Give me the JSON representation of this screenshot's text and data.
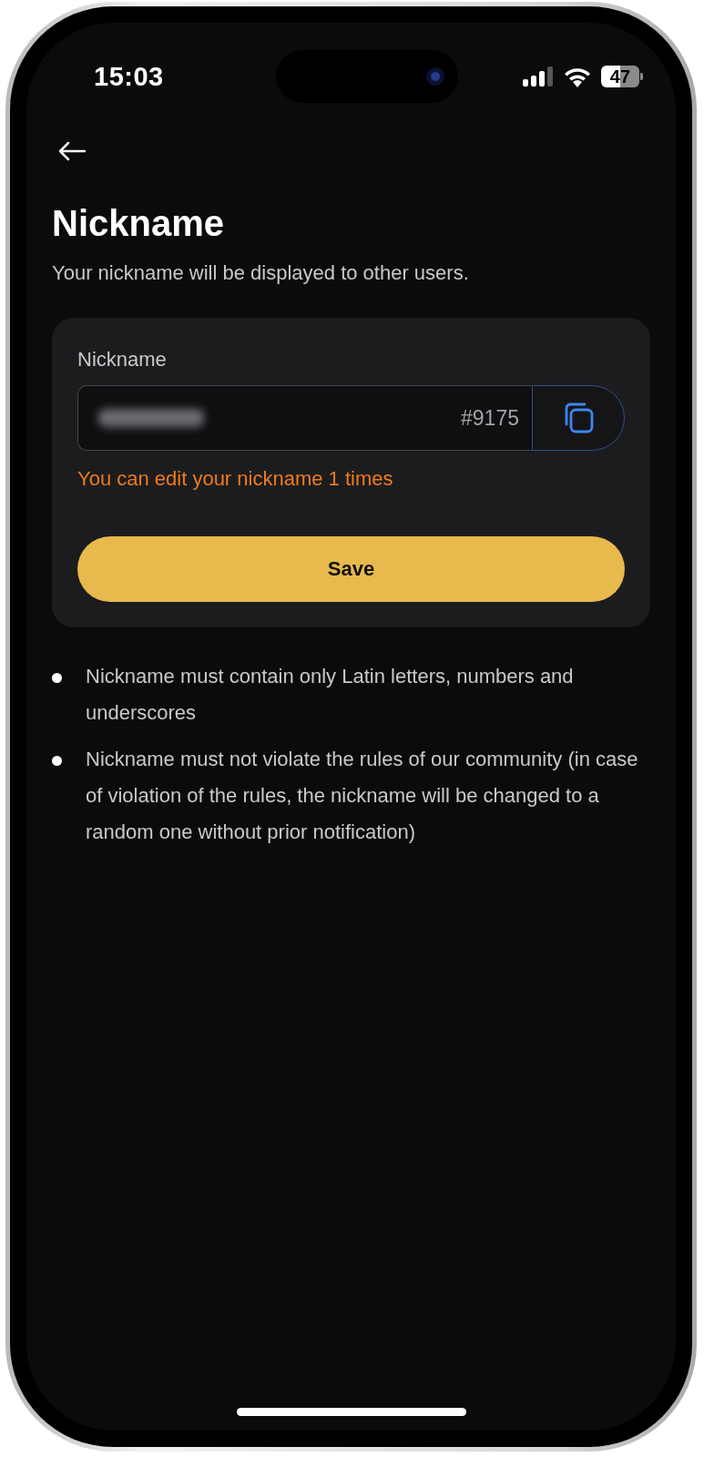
{
  "status_bar": {
    "time": "15:03",
    "battery": "47"
  },
  "page": {
    "title": "Nickname",
    "subtitle": "Your nickname will be displayed to other users."
  },
  "form": {
    "label": "Nickname",
    "tag": "#9175",
    "notice": "You can edit your nickname 1 times",
    "save_button": "Save"
  },
  "rules": [
    "Nickname must contain only Latin letters, numbers and underscores",
    "Nickname must not violate the rules of our community (in case of violation of the rules, the nickname will be changed to a random one without prior notification)"
  ]
}
